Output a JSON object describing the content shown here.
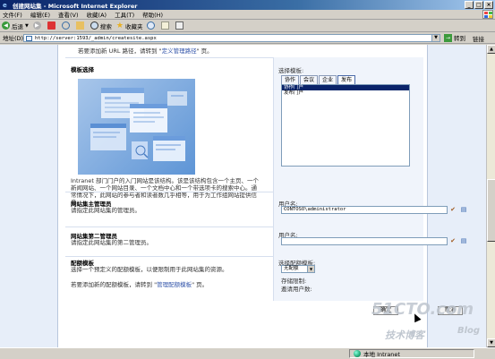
{
  "window": {
    "title": "创建网站集 - Microsoft Internet Explorer",
    "controls": [
      "_",
      "□",
      "×"
    ]
  },
  "menu": [
    "文件(F)",
    "编辑(E)",
    "查看(V)",
    "收藏(A)",
    "工具(T)",
    "帮助(H)"
  ],
  "toolbar": {
    "back": "后退",
    "search": "搜索",
    "favorites": "收藏夹"
  },
  "address": {
    "label": "地址(D)",
    "url": "http://server:1593/_admin/createsite.aspx",
    "go": "转到",
    "links": "链接"
  },
  "page": {
    "top_note_prefix": "若要添加新 URL 路径，请转到 \"",
    "top_note_link": "定义管理路径",
    "top_note_suffix": "\" 页。",
    "template_section": {
      "title": "模板选择",
      "description": "Intranet 部门门户的入门网站是该结构。该是该结构包含一个主页、一个新闻网站、一个网站目录、一个文档中心和一个带选项卡的搜索中心。通常情况下，此网站的参与者和读者数几乎相等，用于为工作组网站提供信息。",
      "choose_label": "选择模板:",
      "tabs": [
        "协作",
        "会议",
        "企业",
        "发布"
      ],
      "active_tab": "发布",
      "items": [
        "协作门户",
        "发布门户"
      ],
      "selected_item": "协作门户"
    },
    "primary_admin": {
      "title": "网站集主管理员",
      "description": "请指定此网站集的管理员。",
      "user_label": "用户名:",
      "user_value": "CONTOSO\\administrator"
    },
    "secondary_admin": {
      "title": "网站集第二管理员",
      "description": "请指定此网站集的第二管理员。",
      "user_label": "用户名:",
      "user_value": ""
    },
    "quota": {
      "title": "配额模板",
      "description": "选择一个预定义的配额模板，以便限制用于此网站集的资源。",
      "note_prefix": "若要添加新的配额模板，请转到 \"",
      "note_link": "管理配额模板",
      "note_suffix": "\" 页。",
      "select_label": "选择配额模板:",
      "select_value": "无配额",
      "storage_limit": "存储限制:",
      "invited_users": "邀请用户数:"
    },
    "buttons": {
      "ok": "确定",
      "cancel": "取消"
    },
    "watermark": {
      "site": "51CTO.com",
      "tagline": "技术博客",
      "blog": "Blog"
    }
  },
  "status": {
    "left": "",
    "zone": "本地 Intranet"
  }
}
